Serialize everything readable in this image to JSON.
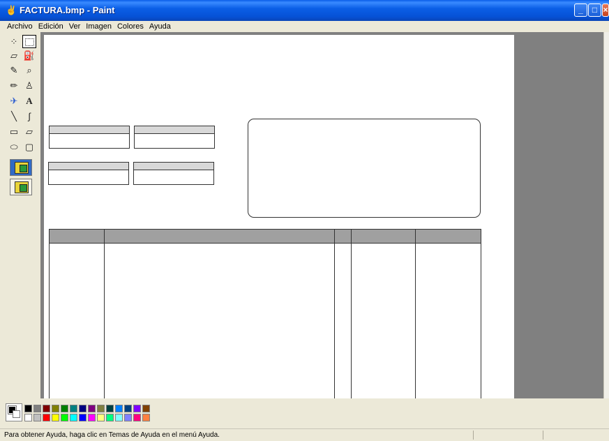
{
  "window": {
    "title": "FACTURA.bmp - Paint",
    "buttons": {
      "minimize": "_",
      "maximize": "□",
      "close": "×"
    }
  },
  "menu": [
    "Archivo",
    "Edición",
    "Ver",
    "Imagen",
    "Colores",
    "Ayuda"
  ],
  "tools": [
    {
      "name": "free-select-icon",
      "glyph": "⁘"
    },
    {
      "name": "select-icon",
      "glyph": ""
    },
    {
      "name": "eraser-icon",
      "glyph": "▱"
    },
    {
      "name": "fill-icon",
      "glyph": "⛽"
    },
    {
      "name": "pick-color-icon",
      "glyph": "✎"
    },
    {
      "name": "magnifier-icon",
      "glyph": "⌕"
    },
    {
      "name": "pencil-icon",
      "glyph": "✏"
    },
    {
      "name": "brush-icon",
      "glyph": "♙"
    },
    {
      "name": "airbrush-icon",
      "glyph": "✈"
    },
    {
      "name": "text-icon",
      "glyph": "A"
    },
    {
      "name": "line-icon",
      "glyph": "╲"
    },
    {
      "name": "curve-icon",
      "glyph": "∫"
    },
    {
      "name": "rectangle-icon",
      "glyph": "▭"
    },
    {
      "name": "polygon-icon",
      "glyph": "▱"
    },
    {
      "name": "ellipse-icon",
      "glyph": "⬭"
    },
    {
      "name": "rounded-rect-icon",
      "glyph": "▢"
    }
  ],
  "palette": {
    "foreground": "#000000",
    "background": "#ffffff",
    "row1": [
      "#000000",
      "#808080",
      "#800000",
      "#808000",
      "#008000",
      "#008080",
      "#000080",
      "#800080",
      "#808040",
      "#004040",
      "#0080ff",
      "#004080",
      "#8000ff",
      "#804000"
    ],
    "row2": [
      "#ffffff",
      "#c0c0c0",
      "#ff0000",
      "#ffff00",
      "#00ff00",
      "#00ffff",
      "#0000ff",
      "#ff00ff",
      "#ffff80",
      "#00ff80",
      "#80ffff",
      "#8080ff",
      "#ff0080",
      "#ff8040"
    ]
  },
  "status": {
    "text": "Para obtener Ayuda, haga clic en Temas de Ayuda en el menú Ayuda."
  }
}
